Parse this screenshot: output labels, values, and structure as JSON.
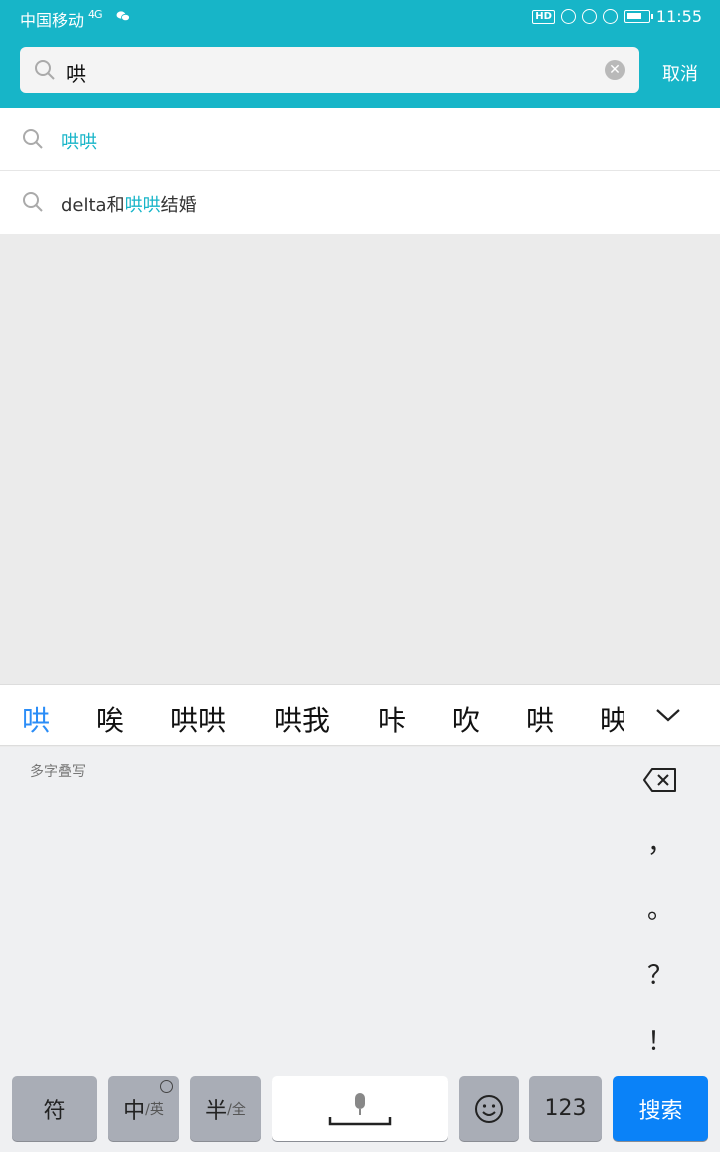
{
  "status_bar": {
    "carrier": "中国移动",
    "network": "4G",
    "hd": "HD",
    "time": "11:55"
  },
  "search": {
    "query": "哄",
    "cancel_label": "取消"
  },
  "suggestions": [
    {
      "parts": [
        {
          "text": "哄哄",
          "highlight": true
        }
      ]
    },
    {
      "parts": [
        {
          "text": "delta和",
          "highlight": false
        },
        {
          "text": "哄哄",
          "highlight": true
        },
        {
          "text": "结婚",
          "highlight": false
        }
      ]
    }
  ],
  "keyboard": {
    "candidates": [
      "哄",
      "唉",
      "哄哄",
      "哄我",
      "咔",
      "吹",
      "哄",
      "映"
    ],
    "handwriting_label": "多字叠写",
    "side_keys": [
      "，",
      "。",
      "？",
      "！"
    ],
    "keys": {
      "symbol": "符",
      "lang_main": "中",
      "lang_alt": "/英",
      "width_main": "半",
      "width_alt": "/全",
      "num": "123",
      "search": "搜索"
    }
  },
  "colors": {
    "header": "#17b5c8",
    "highlight": "#17b5c8",
    "active_candidate": "#2b8df7",
    "search_key": "#0a82f8"
  }
}
